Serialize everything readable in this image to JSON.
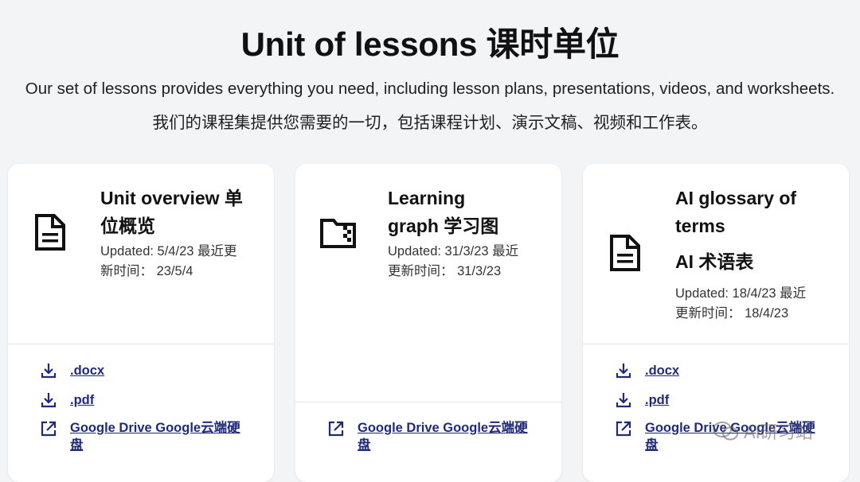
{
  "header": {
    "title": "Unit of lessons 课时单位",
    "intro_en": "Our set of lessons provides everything you need, including lesson plans, presentations, videos, and worksheets.",
    "intro_zh": "我们的课程集提供您需要的一切，包括课程计划、演示文稿、视频和工作表。"
  },
  "cards": [
    {
      "title_line1": "Unit overview 单",
      "title_line2": "位概览",
      "updated_line1": "Updated: 5/4/23 最近更",
      "updated_line2": "新时间： 23/5/4",
      "icon": "document-icon",
      "links": [
        {
          "label": ".docx",
          "icon": "download-icon"
        },
        {
          "label": ".pdf",
          "icon": "download-icon"
        },
        {
          "label_line1": "Google Drive Google云端硬",
          "label_line2": "盘",
          "icon": "external-link-icon"
        }
      ]
    },
    {
      "title_line1": "Learning",
      "title_line2": "graph 学习图",
      "updated_line1": "Updated: 31/3/23 最近",
      "updated_line2": "更新时间： 31/3/23",
      "icon": "folder-icon",
      "links": [
        {
          "label_line1": "Google Drive Google云端硬",
          "label_line2": "盘",
          "icon": "external-link-icon"
        }
      ]
    },
    {
      "title_line1": "AI glossary of",
      "title_line2": "terms",
      "title_line3": "AI 术语表",
      "updated_line1": "Updated: 18/4/23 最近",
      "updated_line2": "更新时间： 18/4/23",
      "icon": "document-icon",
      "links": [
        {
          "label": ".docx",
          "icon": "download-icon"
        },
        {
          "label": ".pdf",
          "icon": "download-icon"
        },
        {
          "label_line1": "Google Drive Google云端硬",
          "label_line2": "盘",
          "icon": "external-link-icon"
        }
      ]
    }
  ],
  "watermark": {
    "text": "AI研习站"
  },
  "colors": {
    "link": "#1f2a7a",
    "background": "#f3f4f6",
    "card": "#ffffff"
  }
}
